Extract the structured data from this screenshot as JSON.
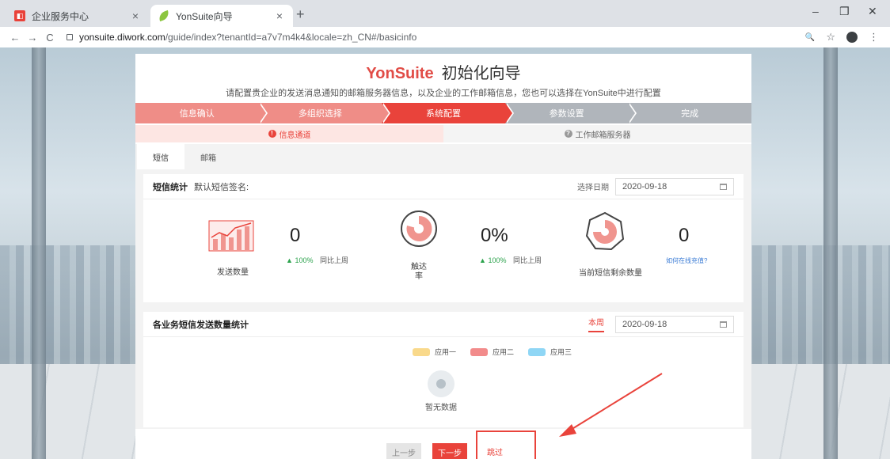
{
  "browser": {
    "tabs": [
      {
        "title": "企业服务中心",
        "close": "×"
      },
      {
        "title": "YonSuite向导",
        "close": "×"
      }
    ],
    "new_tab": "+",
    "window_controls": {
      "minimize": "–",
      "restore": "❐",
      "close": "✕"
    },
    "nav": {
      "back": "←",
      "forward": "→",
      "reload": "C"
    },
    "url_host": "yonsuite.diwork.com",
    "url_path": "/guide/index?tenantId=a7v7m4k4&locale=zh_CN#/basicinfo",
    "toolbar_icons": {
      "zoom": "🔍",
      "star": "☆",
      "menu": "⋮"
    }
  },
  "wizard": {
    "brand_yon": "Yon",
    "brand_suite": "Suite",
    "brand_sub": "初始化向导",
    "subtitle": "请配置贵企业的发送消息通知的邮箱服务器信息，以及企业的工作邮箱信息，您也可以选择在YonSuite中进行配置",
    "steps": [
      {
        "label": "信息确认",
        "state": "done"
      },
      {
        "label": "多组织选择",
        "state": "done"
      },
      {
        "label": "系统配置",
        "state": "current"
      },
      {
        "label": "参数设置",
        "state": "todo"
      },
      {
        "label": "完成",
        "state": "todo"
      }
    ],
    "substeps": [
      {
        "label": "信息通道",
        "icon": "!",
        "state": "active"
      },
      {
        "label": "工作邮箱服务器",
        "icon": "?",
        "state": "inactive"
      }
    ],
    "tabs": [
      "短信",
      "邮箱"
    ],
    "sms_stats": {
      "title": "短信统计",
      "signature_label": "默认短信签名:",
      "date_label": "选择日期",
      "date_value": "2020-09-18",
      "send_count_label": "发送数量",
      "send_count_value": "0",
      "send_trend_pct": "100%",
      "send_trend_text": "同比上周",
      "reach_rate_label_1": "触达",
      "reach_rate_label_2": "率",
      "reach_rate_value": "0%",
      "reach_trend_pct": "100%",
      "reach_trend_text": "同比上周",
      "remaining_label": "当前短信剩余数量",
      "remaining_value": "0",
      "recharge_link": "如何在线充值?"
    },
    "biz_stats": {
      "title": "各业务短信发送数量统计",
      "week_tab": "本周",
      "date_value": "2020-09-18",
      "legend": [
        {
          "label": "应用一",
          "color": "#f9d98b"
        },
        {
          "label": "应用二",
          "color": "#f28b8b"
        },
        {
          "label": "应用三",
          "color": "#8fd6f5"
        }
      ],
      "empty_text": "暂无数据"
    },
    "buttons": {
      "prev": "上一步",
      "next": "下一步",
      "skip": "跳过"
    }
  },
  "colors": {
    "accent": "#e9433b",
    "done": "#ef8d87",
    "todo": "#b0b5bb",
    "trend_up": "#2ba24c"
  }
}
